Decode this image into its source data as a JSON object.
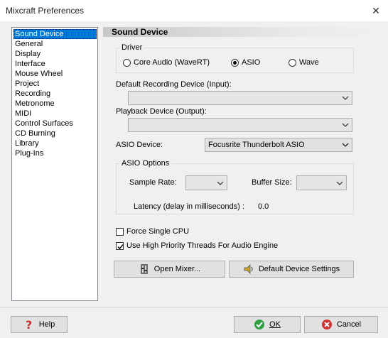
{
  "window": {
    "title": "Mixcraft Preferences",
    "close_glyph": "✕"
  },
  "sidebar": {
    "items": [
      {
        "label": "Sound Device",
        "selected": true
      },
      {
        "label": "General"
      },
      {
        "label": "Display"
      },
      {
        "label": "Interface"
      },
      {
        "label": "Mouse Wheel"
      },
      {
        "label": "Project"
      },
      {
        "label": "Recording"
      },
      {
        "label": "Metronome"
      },
      {
        "label": "MIDI"
      },
      {
        "label": "Control Surfaces"
      },
      {
        "label": "CD Burning"
      },
      {
        "label": "Library"
      },
      {
        "label": "Plug-Ins"
      }
    ]
  },
  "panel": {
    "title": "Sound Device",
    "driver": {
      "group_label": "Driver",
      "options": [
        {
          "label": "Core Audio (WaveRT)",
          "checked": false
        },
        {
          "label": "ASIO",
          "checked": true
        },
        {
          "label": "Wave",
          "checked": false
        }
      ]
    },
    "recording_device": {
      "label": "Default Recording Device (Input):",
      "value": ""
    },
    "playback_device": {
      "label": "Playback Device (Output):",
      "value": ""
    },
    "asio_device": {
      "label": "ASIO Device:",
      "value": "Focusrite Thunderbolt ASIO"
    },
    "asio_options": {
      "group_label": "ASIO Options",
      "sample_rate_label": "Sample Rate:",
      "sample_rate_value": "",
      "buffer_size_label": "Buffer Size:",
      "buffer_size_value": "",
      "latency_label": "Latency (delay in milliseconds) :",
      "latency_value": "0.0"
    },
    "force_single_cpu": {
      "label": "Force Single CPU",
      "checked": false
    },
    "high_priority": {
      "label": "Use High Priority Threads For Audio Engine",
      "checked": true
    },
    "open_mixer_label": "Open Mixer...",
    "default_device_label": "Default Device Settings"
  },
  "footer": {
    "help_label": "Help",
    "ok_label": "OK",
    "cancel_label": "Cancel"
  },
  "colors": {
    "selection": "#0078d7",
    "ok_icon": "#2ea043",
    "cancel_icon": "#d32f2f",
    "help_icon": "#d32f2f"
  }
}
